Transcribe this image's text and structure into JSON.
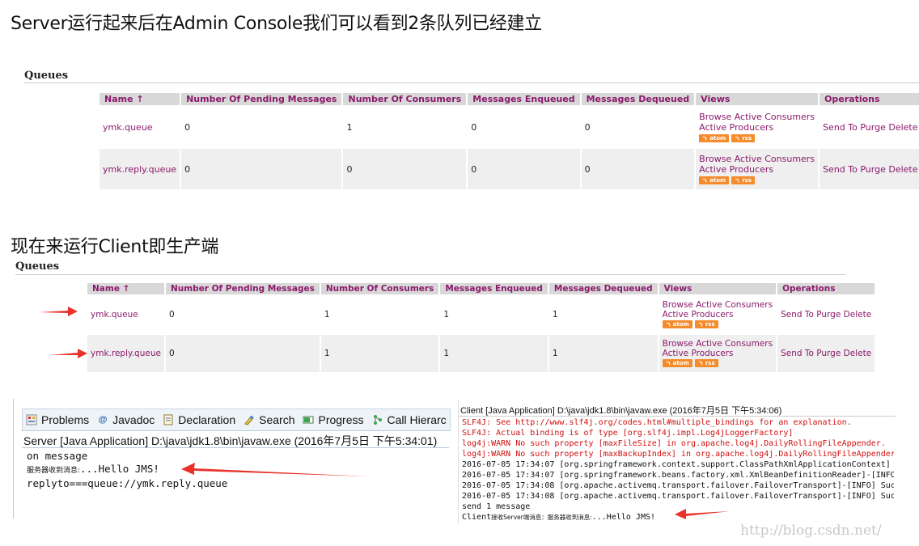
{
  "heading1": "Server运行起来后在Admin Console我们可以看到2条队列已经建立",
  "heading2": "现在来运行Client即生产端",
  "table1": {
    "section_title": "Queues",
    "columns": [
      "Name ↑",
      "Number Of Pending Messages",
      "Number Of Consumers",
      "Messages Enqueued",
      "Messages Dequeued",
      "Views",
      "Operations"
    ],
    "rows": [
      {
        "name": "ymk.queue",
        "pending": "0",
        "consumers": "1",
        "enqueued": "0",
        "dequeued": "0"
      },
      {
        "name": "ymk.reply.queue",
        "pending": "0",
        "consumers": "0",
        "enqueued": "0",
        "dequeued": "0"
      }
    ]
  },
  "table2": {
    "section_title": "Queues",
    "columns": [
      "Name ↑",
      "Number Of Pending Messages",
      "Number Of Consumers",
      "Messages Enqueued",
      "Messages Dequeued",
      "Views",
      "Operations"
    ],
    "rows": [
      {
        "name": "ymk.queue",
        "pending": "0",
        "consumers": "1",
        "enqueued": "1",
        "dequeued": "1"
      },
      {
        "name": "ymk.reply.queue",
        "pending": "0",
        "consumers": "1",
        "enqueued": "1",
        "dequeued": "1"
      }
    ]
  },
  "views": {
    "browse": "Browse Active Consumers",
    "producers": "Active Producers",
    "atom": "atom",
    "rss": "rss"
  },
  "operations": {
    "send": "Send To",
    "purge": "Purge",
    "delete": "Delete"
  },
  "eclipse": {
    "tabs": [
      {
        "label": "Problems",
        "icon": "problems-icon"
      },
      {
        "label": "Javadoc",
        "icon": "javadoc-icon"
      },
      {
        "label": "Declaration",
        "icon": "declaration-icon"
      },
      {
        "label": "Search",
        "icon": "search-icon"
      },
      {
        "label": "Progress",
        "icon": "progress-icon"
      },
      {
        "label": "Call Hierarc",
        "icon": "call-hierarchy-icon"
      }
    ],
    "console_title": "Server [Java Application] D:\\java\\jdk1.8\\bin\\javaw.exe (2016年7月5日 下午5:34:01)",
    "line1": "on message",
    "line2_prefix": "服务器收到消息:",
    "line2_rest": "...Hello JMS!",
    "line3": "replyto===queue://ymk.reply.queue"
  },
  "client": {
    "title": "Client [Java Application] D:\\java\\jdk1.8\\bin\\javaw.exe (2016年7月5日 下午5:34:06)",
    "lines_red": [
      "SLF4J: See http://www.slf4j.org/codes.html#multiple_bindings for an explanation.",
      "SLF4J: Actual binding is of type [org.slf4j.impl.Log4jLoggerFactory]",
      "log4j:WARN No such property [maxFileSize] in org.apache.log4j.DailyRollingFileAppender.",
      "log4j:WARN No such property [maxBackupIndex] in org.apache.log4j.DailyRollingFileAppender"
    ],
    "lines_black": [
      "2016-07-05 17:34:07 [org.springframework.context.support.ClassPathXmlApplicationContext]",
      "2016-07-05 17:34:07 [org.springframework.beans.factory.xml.XmlBeanDefinitionReader]-[INFO",
      "2016-07-05 17:34:08 [org.apache.activemq.transport.failover.FailoverTransport]-[INFO] Suc",
      "2016-07-05 17:34:08 [org.apache.activemq.transport.failover.FailoverTransport]-[INFO] Suc",
      "send 1 message"
    ],
    "last_prefix": "Client",
    "last_cn": "接收Server端消息：服务器收到消息:",
    "last_rest": "...Hello JMS!"
  },
  "watermark": "http://blog.csdn.net/",
  "colors": {
    "link": "#8b1a6b",
    "header_bg": "#d8d8d8",
    "feed": "#f58b2b",
    "arrow": "#e8322a",
    "console_red": "#d01010"
  }
}
